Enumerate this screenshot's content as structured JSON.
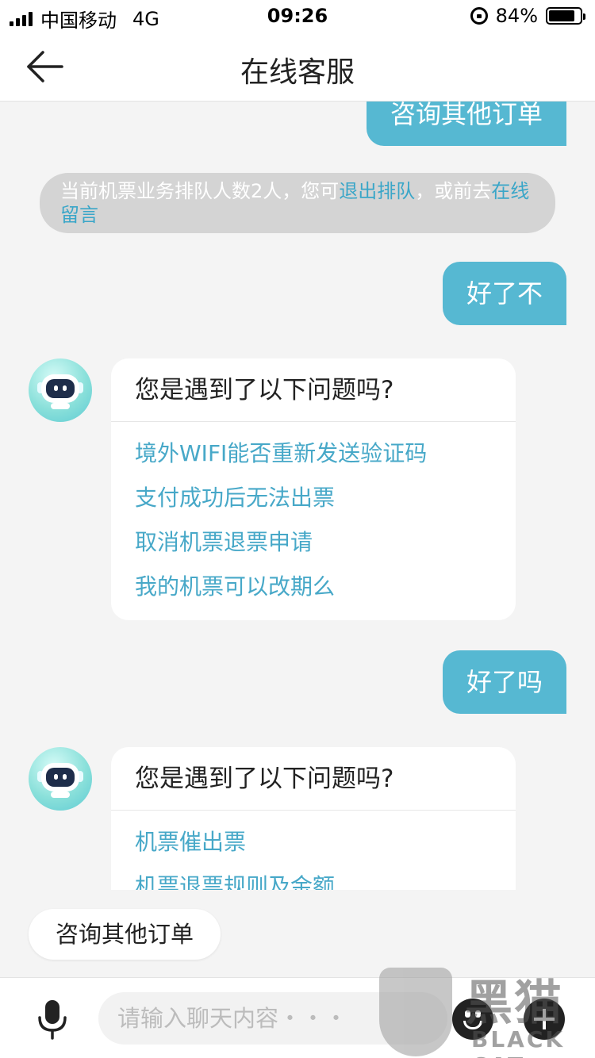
{
  "status_bar": {
    "carrier": "中国移动",
    "network": "4G",
    "time": "09:26",
    "battery_percent": "84%",
    "battery_level": 0.84
  },
  "header": {
    "title": "在线客服",
    "back_icon": "arrow-left-icon"
  },
  "messages": {
    "m1_user": "咨询其他订单",
    "notice": {
      "prefix": "当前机票业务排队人数2人，您可",
      "link1": "退出排队",
      "middle": "，或前去",
      "link2": "在线留言"
    },
    "m2_user": "好了不",
    "m3_bot": {
      "question": "您是遇到了以下问题吗?",
      "options": [
        "境外WIFI能否重新发送验证码",
        "支付成功后无法出票",
        "取消机票退票申请",
        "我的机票可以改期么"
      ]
    },
    "m4_user": "好了吗",
    "m5_bot": {
      "question": "您是遇到了以下问题吗?",
      "options": [
        "机票催出票",
        "机票退票规则及金额"
      ]
    }
  },
  "quick_reply": "咨询其他订单",
  "input_bar": {
    "placeholder": "请输入聊天内容・・・",
    "mic_icon": "microphone-icon",
    "emoji_icon": "emoji-icon",
    "plus_icon": "plus-icon"
  },
  "watermark": {
    "text_big": "黑猫",
    "text_small": "BLACK CAT"
  },
  "colors": {
    "accent": "#56b8d2",
    "link": "#47a8c8",
    "background": "#f4f4f4"
  }
}
